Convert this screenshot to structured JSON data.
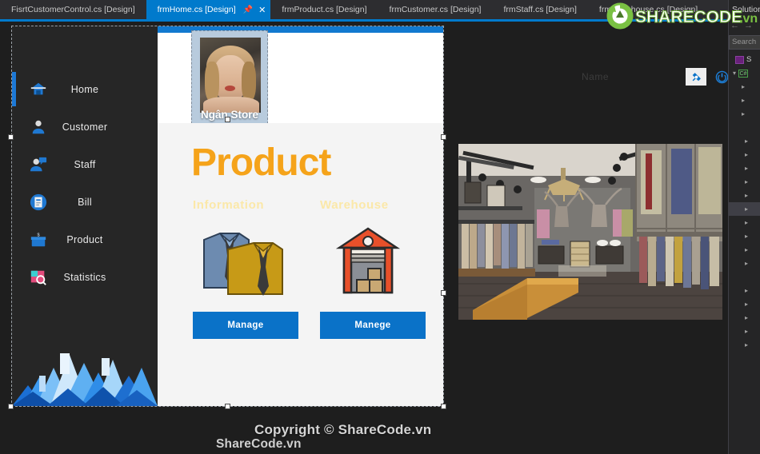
{
  "ide": {
    "tabs": [
      {
        "label": "FisrtCustomerControl.cs [Design]",
        "active": false
      },
      {
        "label": "frmHome.cs [Design]",
        "active": true
      },
      {
        "label": "frmProduct.cs [Design]",
        "active": false
      },
      {
        "label": "frmCustomer.cs [Design]",
        "active": false
      },
      {
        "label": "frmStaff.cs [Design]",
        "active": false
      },
      {
        "label": "frmWarehouse.cs [Design]",
        "active": false
      }
    ],
    "active_tab_pin_icon": "pin-icon",
    "active_tab_close_icon": "close-icon",
    "overflow_icon": "tab-overflow-icon",
    "settings_icon": "gear-icon"
  },
  "solution_explorer": {
    "title": "Solution",
    "back_icon": "back-arrow-icon",
    "forward_icon": "forward-arrow-icon",
    "search_placeholder": "Search",
    "project_node": "S",
    "cs_node": "C#"
  },
  "form": {
    "sidebar": {
      "items": [
        {
          "label": "Home",
          "icon": "home-icon",
          "active": true
        },
        {
          "label": "Customer",
          "icon": "customer-icon",
          "active": false
        },
        {
          "label": "Staff",
          "icon": "staff-icon",
          "active": false
        },
        {
          "label": "Bill",
          "icon": "bill-icon",
          "active": false
        },
        {
          "label": "Product",
          "icon": "product-icon",
          "active": false
        },
        {
          "label": "Statistics",
          "icon": "statistics-icon",
          "active": false
        }
      ],
      "decoration_icon": "polygon-mountain-graphic"
    },
    "header": {
      "logo_name": "Ngân Store",
      "logo_image": "store-owner-photo",
      "user_name": "Name",
      "pin_icon": "pin-icon",
      "power_icon": "power-icon"
    },
    "main": {
      "title": "Product",
      "sections": [
        {
          "label": "Information",
          "icon": "shirt-tie-icon",
          "button": "Manage"
        },
        {
          "label": "Warehouse",
          "icon": "warehouse-icon",
          "button": "Manege"
        }
      ],
      "photo": "clothing-store-interior-photo"
    },
    "footer_text": "ShareCode.vn"
  },
  "watermark": {
    "logo_text_a": "SHARECODE",
    "logo_text_b": ".vn",
    "copyright": "Copyright © ShareCode.vn"
  },
  "colors": {
    "vs_accent": "#007acc",
    "form_blue": "#1179cf",
    "button_blue": "#0a72c8",
    "title_orange": "#f5a31a",
    "sub_label_yellow": "#fbe8a8",
    "nav_dark": "#262626"
  }
}
